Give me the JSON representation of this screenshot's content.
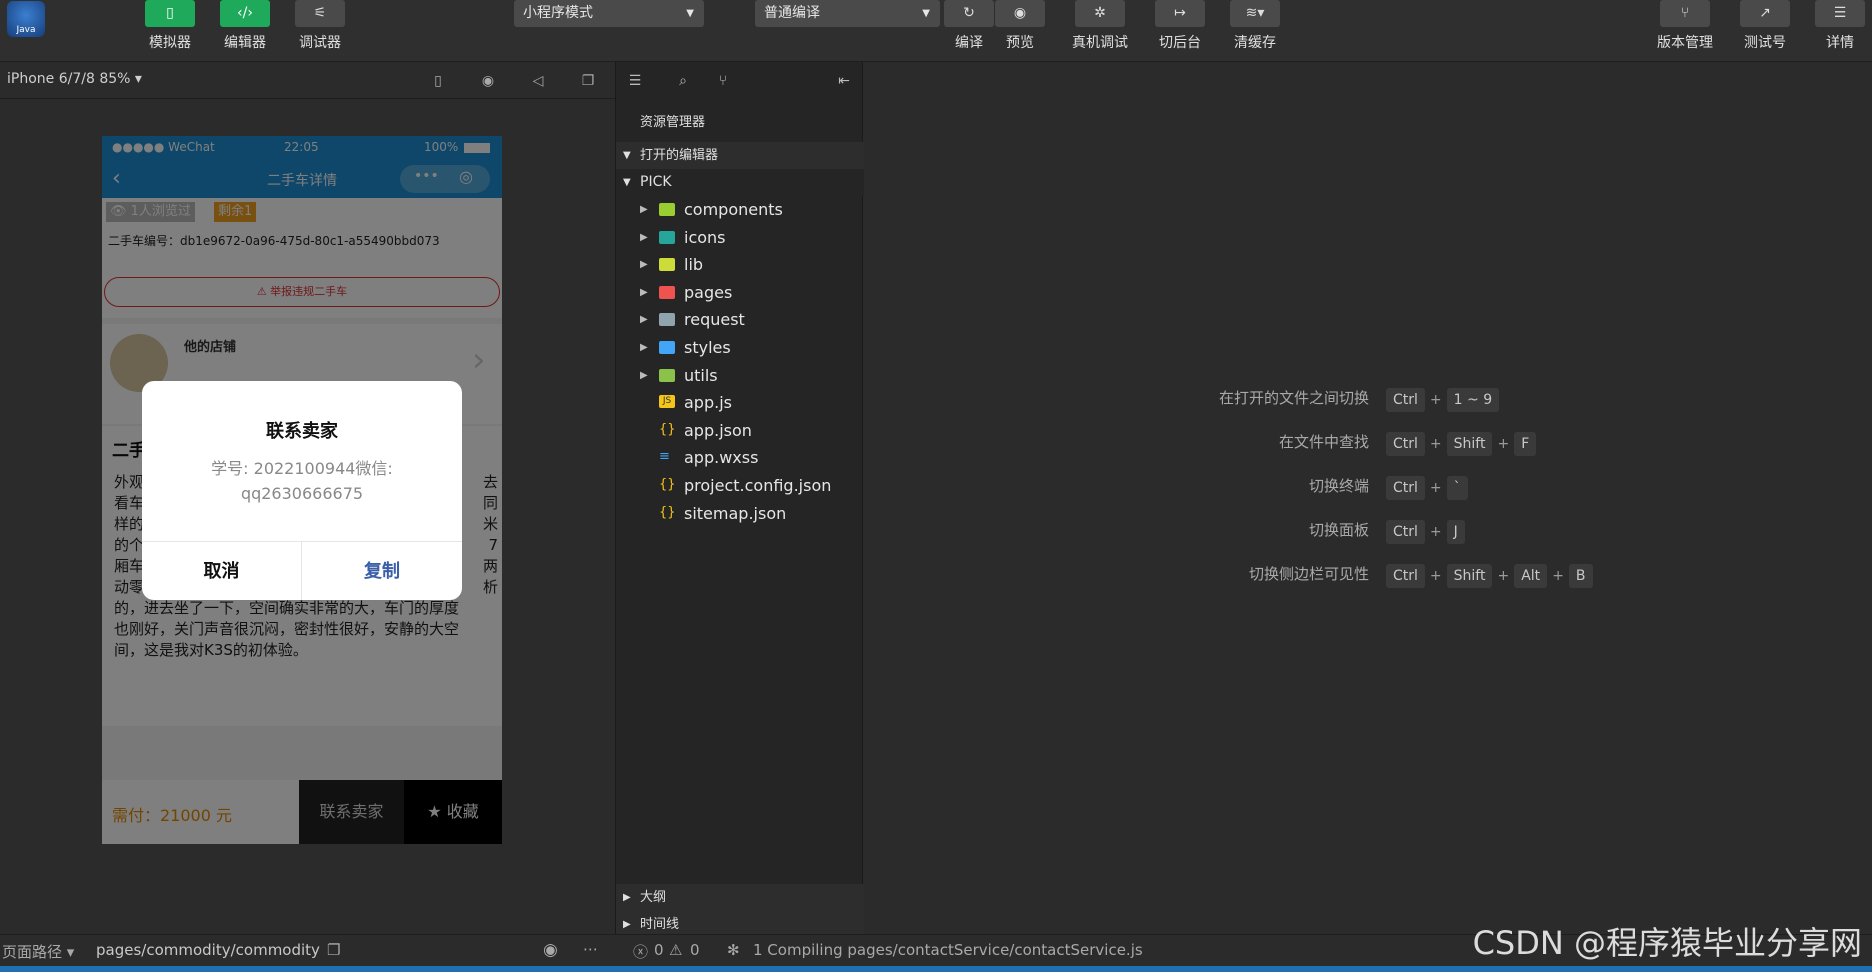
{
  "toolbar": {
    "simulator_label": "模拟器",
    "editor_label": "编辑器",
    "debugger_label": "调试器",
    "mode_select": "小程序模式",
    "compile_select": "普通编译",
    "compile_label": "编译",
    "preview_label": "预览",
    "real_debug_label": "真机调试",
    "backstage_label": "切后台",
    "clear_cache_label": "清缓存",
    "version_label": "版本管理",
    "test_label": "测试号",
    "details_label": "详情"
  },
  "logo_text": "Java",
  "simulator": {
    "device": "iPhone 6/7/8 85% ▾",
    "status_left": "●●●●● WeChat",
    "status_time": "22:05",
    "status_battery": "100%",
    "nav_title": "二手车详情",
    "views_badge": "1人浏览过",
    "remain_badge": "剩余1",
    "car_id": "二手车编号：db1e9672-0a96-475d-80c1-a55490bbd073",
    "report": "⚠ 举报违规二手车",
    "store": "他的店铺",
    "section_title": "二手",
    "desc_lines": [
      "外观",
      "看车",
      "样的",
      "的个",
      "厢车",
      "动零",
      "的，进去坐了一下，空间确实非常的大，车门的厚度",
      "也刚好，关门声音很沉闷，密封性很好，安静的大空",
      "间，这是我对K3S的初体验。"
    ],
    "desc_right": [
      "去",
      "同",
      "米7",
      "两",
      "析"
    ],
    "price": "需付：21000 元",
    "contact_btn": "联系卖家",
    "fav_btn": "★ 收藏"
  },
  "modal": {
    "title": "联系卖家",
    "content_line1": "学号: 2022100944微信:",
    "content_line2": "qq2630666675",
    "cancel": "取消",
    "copy": "复制"
  },
  "explorer": {
    "title": "资源管理器",
    "open_editors": "打开的编辑器",
    "project": "PICK",
    "items": [
      {
        "name": "components",
        "type": "folder",
        "color": "#9acd32"
      },
      {
        "name": "icons",
        "type": "folder",
        "color": "#26a69a"
      },
      {
        "name": "lib",
        "type": "folder",
        "color": "#cddc39"
      },
      {
        "name": "pages",
        "type": "folder",
        "color": "#ef5350"
      },
      {
        "name": "request",
        "type": "folder",
        "color": "#90a4ae"
      },
      {
        "name": "styles",
        "type": "folder",
        "color": "#42a5f5"
      },
      {
        "name": "utils",
        "type": "folder",
        "color": "#8bc34a"
      },
      {
        "name": "app.js",
        "type": "js",
        "color": "#f5c518"
      },
      {
        "name": "app.json",
        "type": "json",
        "color": "#f5c518"
      },
      {
        "name": "app.wxss",
        "type": "css",
        "color": "#42a5f5"
      },
      {
        "name": "project.config.json",
        "type": "json",
        "color": "#f5c518"
      },
      {
        "name": "sitemap.json",
        "type": "json",
        "color": "#f5c518"
      }
    ],
    "outline": "大纲",
    "timeline": "时间线"
  },
  "shortcuts": [
    {
      "desc": "在打开的文件之间切换",
      "keys": [
        "Ctrl",
        "1 ~ 9"
      ]
    },
    {
      "desc": "在文件中查找",
      "keys": [
        "Ctrl",
        "Shift",
        "F"
      ]
    },
    {
      "desc": "切换终端",
      "keys": [
        "Ctrl",
        "`"
      ]
    },
    {
      "desc": "切换面板",
      "keys": [
        "Ctrl",
        "J"
      ]
    },
    {
      "desc": "切换侧边栏可见性",
      "keys": [
        "Ctrl",
        "Shift",
        "Alt",
        "B"
      ]
    }
  ],
  "statusbar": {
    "page_path_label": "页面路径 ▾",
    "page_path": "pages/commodity/commodity",
    "errors": "0",
    "warnings": "0",
    "compiling": "1 Compiling pages/contactService/contactService.js"
  },
  "watermark": "CSDN @程序猿毕业分享网",
  "colors": {
    "accent_green": "#1fa95a",
    "phone_blue": "#1c8fd2",
    "modal_copy": "#3b5ea8"
  }
}
